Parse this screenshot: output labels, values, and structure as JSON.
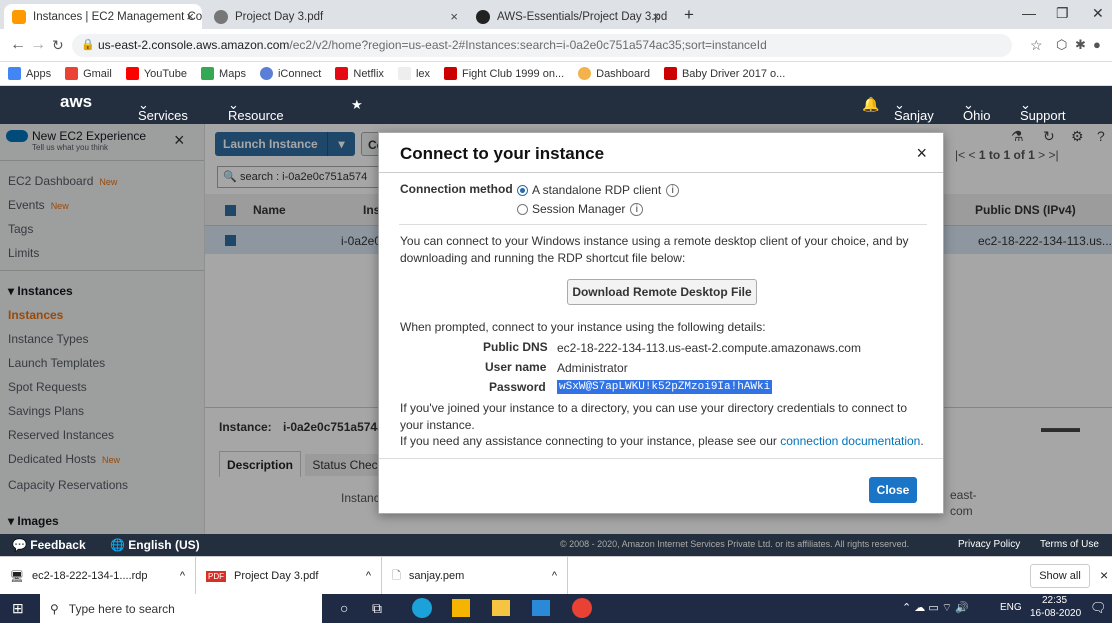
{
  "browser": {
    "tabs": [
      {
        "title": "Instances | EC2 Management Co",
        "close": "×"
      },
      {
        "title": "Project Day 3.pdf",
        "close": "×"
      },
      {
        "title": "AWS-Essentials/Project Day 3.pd",
        "close": "×"
      }
    ],
    "new_tab": "+",
    "window_controls": {
      "minimize": "—",
      "restore": "❐",
      "close": "✕"
    },
    "url_host": "us-east-2.console.aws.amazon.com",
    "url_path": "/ec2/v2/home?region=us-east-2#Instances:search=i-0a2e0c751a574ac35;sort=instanceId",
    "bookmarks": [
      "Apps",
      "Gmail",
      "YouTube",
      "Maps",
      "iConnect",
      "Netflix",
      "lex",
      "Fight Club 1999 on...",
      "Dashboard",
      "Baby Driver 2017 o..."
    ]
  },
  "aws_header": {
    "logo": "aws",
    "services": "Services",
    "resource_groups": "Resource Groups",
    "user": "Sanjay",
    "region": "Ohio",
    "support": "Support"
  },
  "sidebar": {
    "experience_title": "New EC2 Experience",
    "experience_sub": "Tell us what you think",
    "items": [
      {
        "label": "EC2 Dashboard",
        "badge": "New"
      },
      {
        "label": "Events",
        "badge": "New"
      },
      {
        "label": "Tags",
        "badge": ""
      },
      {
        "label": "Limits",
        "badge": ""
      },
      {
        "label": "Instances",
        "badge": ""
      },
      {
        "label": "Instances",
        "badge": ""
      },
      {
        "label": "Instance Types",
        "badge": ""
      },
      {
        "label": "Launch Templates",
        "badge": ""
      },
      {
        "label": "Spot Requests",
        "badge": ""
      },
      {
        "label": "Savings Plans",
        "badge": ""
      },
      {
        "label": "Reserved Instances",
        "badge": ""
      },
      {
        "label": "Dedicated Hosts",
        "badge": "New"
      },
      {
        "label": "Capacity Reservations",
        "badge": ""
      },
      {
        "label": "Images",
        "badge": ""
      }
    ]
  },
  "main": {
    "launch_button": "Launch Instance",
    "connect_button_partial": "Co",
    "search_text": "search : i-0a2e0c751a574",
    "pagination": "1 to 1 of 1",
    "columns": [
      "Name",
      "Instan",
      "Public DNS (IPv4)"
    ],
    "row": {
      "instance": "i-0a2e0",
      "dns": "ec2-18-222-134-113.us..."
    },
    "instance_label": "Instance:",
    "instance_id_partial": "i-0a2e0c751a574a",
    "detail_tabs": [
      "Description",
      "Status Chec"
    ],
    "detail_instance_partial": "Instance",
    "detail_right_a": "east-",
    "detail_right_b": "com"
  },
  "modal": {
    "title": "Connect to your instance",
    "close_icon": "×",
    "connection_method_label": "Connection method",
    "options": [
      "A standalone RDP client",
      "Session Manager"
    ],
    "intro": "You can connect to your Windows instance using a remote desktop client of your choice, and by downloading and running the RDP shortcut file below:",
    "download_button": "Download Remote Desktop File",
    "prompt": "When prompted, connect to your instance using the following details:",
    "details": [
      {
        "label": "Public DNS",
        "value": "ec2-18-222-134-113.us-east-2.compute.amazonaws.com"
      },
      {
        "label": "User name",
        "value": "Administrator"
      },
      {
        "label": "Password",
        "value": "wSxW@S7apLWKU!k52pZMzoi9Ia!hAWki"
      }
    ],
    "directory_note": "If you've joined your instance to a directory, you can use your directory credentials to connect to your instance.",
    "assist_prefix": "If you need any assistance connecting to your instance, please see our",
    "assist_link": "connection documentation",
    "assist_suffix": ".",
    "close_button": "Close"
  },
  "footer": {
    "feedback": "Feedback",
    "language": "English (US)",
    "copyright": "© 2008 - 2020, Amazon Internet Services Private Ltd. or its affiliates. All rights reserved.",
    "privacy": "Privacy Policy",
    "terms": "Terms of Use"
  },
  "downloads": {
    "items": [
      "ec2-18-222-134-1....rdp",
      "Project Day 3.pdf",
      "sanjay.pem"
    ],
    "show_all": "Show all",
    "close": "×"
  },
  "taskbar": {
    "search_placeholder": "Type here to search",
    "lang": "ENG",
    "time": "22:35",
    "date": "16-08-2020"
  },
  "colors": {
    "aws_nav": "#232f3e",
    "launch_blue": "#2e6da4",
    "link_blue": "#0073bb",
    "accent_orange": "#ec7211"
  }
}
